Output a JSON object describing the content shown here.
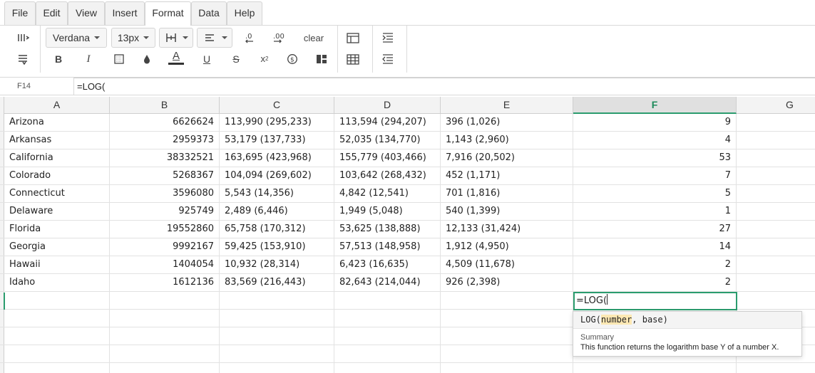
{
  "menu": [
    "File",
    "Edit",
    "View",
    "Insert",
    "Format",
    "Data",
    "Help"
  ],
  "active_menu": "Format",
  "toolbar": {
    "font_family": "Verdana",
    "font_size": "13px",
    "clear_label": "clear"
  },
  "formula_bar": {
    "cell_ref": "F14",
    "formula": "=LOG("
  },
  "columns": [
    "A",
    "B",
    "C",
    "D",
    "E",
    "F",
    "G"
  ],
  "selected_column": "F",
  "rows": [
    [
      "Arizona",
      "6626624",
      "113,990 (295,233)",
      "113,594 (294,207)",
      "396 (1,026)",
      "9",
      ""
    ],
    [
      "Arkansas",
      "2959373",
      "53,179 (137,733)",
      "52,035 (134,770)",
      "1,143 (2,960)",
      "4",
      ""
    ],
    [
      "California",
      "38332521",
      "163,695 (423,968)",
      "155,779 (403,466)",
      "7,916 (20,502)",
      "53",
      ""
    ],
    [
      "Colorado",
      "5268367",
      "104,094 (269,602)",
      "103,642 (268,432)",
      "452 (1,171)",
      "7",
      ""
    ],
    [
      "Connecticut",
      "3596080",
      "5,543 (14,356)",
      "4,842 (12,541)",
      "701 (1,816)",
      "5",
      ""
    ],
    [
      "Delaware",
      "925749",
      "2,489 (6,446)",
      "1,949 (5,048)",
      "540 (1,399)",
      "1",
      ""
    ],
    [
      "Florida",
      "19552860",
      "65,758 (170,312)",
      "53,625 (138,888)",
      "12,133 (31,424)",
      "27",
      ""
    ],
    [
      "Georgia",
      "9992167",
      "59,425 (153,910)",
      "57,513 (148,958)",
      "1,912 (4,950)",
      "14",
      ""
    ],
    [
      "Hawaii",
      "1404054",
      "10,932 (28,314)",
      "6,423 (16,635)",
      "4,509 (11,678)",
      "2",
      ""
    ],
    [
      "Idaho",
      "1612136",
      "83,569 (216,443)",
      "82,643 (214,044)",
      "926 (2,398)",
      "2",
      ""
    ]
  ],
  "editor": {
    "value": "=LOG("
  },
  "autocomplete": {
    "fn": "LOG(",
    "arg1": "number",
    "sep": ", ",
    "arg2": "base",
    "close": ")",
    "summary_label": "Summary",
    "summary_text": "This function returns the logarithm base Y of a number X."
  },
  "colors": {
    "accent": "#2b9c6e"
  }
}
